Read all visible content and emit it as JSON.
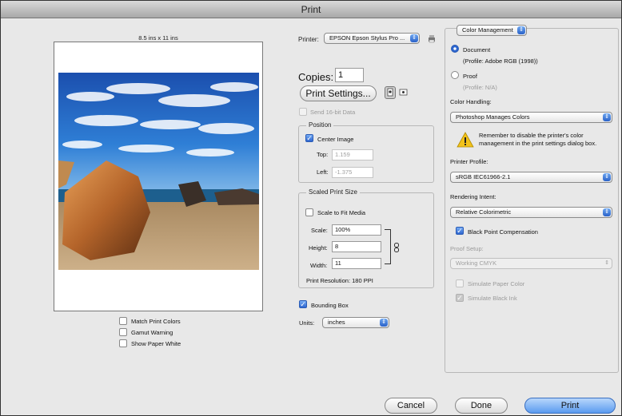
{
  "window": {
    "title": "Print"
  },
  "preview": {
    "paper_size": "8.5 ins x 11 ins"
  },
  "left_options": [
    {
      "label": "Match Print Colors",
      "checked": false
    },
    {
      "label": "Gamut Warning",
      "checked": false
    },
    {
      "label": "Show Paper White",
      "checked": false
    }
  ],
  "printer": {
    "label": "Printer:",
    "value": "EPSON Epson Stylus Pro ..."
  },
  "copies": {
    "label": "Copies:",
    "value": "1"
  },
  "print_settings_button": "Print Settings...",
  "send16bit": {
    "label": "Send 16-bit Data",
    "checked": false,
    "enabled": false
  },
  "position": {
    "title": "Position",
    "center_image": {
      "label": "Center Image",
      "checked": true
    },
    "top": {
      "label": "Top:",
      "value": "1.159"
    },
    "left": {
      "label": "Left:",
      "value": "-1.375"
    }
  },
  "scaled_print_size": {
    "title": "Scaled Print Size",
    "scale_to_fit": {
      "label": "Scale to Fit Media",
      "checked": false
    },
    "scale": {
      "label": "Scale:",
      "value": "100%"
    },
    "height": {
      "label": "Height:",
      "value": "8"
    },
    "width": {
      "label": "Width:",
      "value": "11"
    },
    "resolution": "Print Resolution: 180 PPI"
  },
  "bounding_box": {
    "label": "Bounding Box",
    "checked": true
  },
  "units": {
    "label": "Units:",
    "value": "inches"
  },
  "color_management": {
    "section": "Color Management",
    "document": {
      "label": "Document",
      "profile": "(Profile: Adobe RGB (1998))",
      "selected": true
    },
    "proof": {
      "label": "Proof",
      "profile": "(Profile: N/A)",
      "selected": false
    },
    "color_handling_label": "Color Handling:",
    "color_handling": "Photoshop Manages Colors",
    "warning": "Remember to disable the printer's color management in the print settings dialog box.",
    "printer_profile_label": "Printer Profile:",
    "printer_profile": "sRGB IEC61966-2.1",
    "rendering_intent_label": "Rendering Intent:",
    "rendering_intent": "Relative Colorimetric",
    "black_point": {
      "label": "Black Point Compensation",
      "checked": true
    },
    "proof_setup_label": "Proof Setup:",
    "proof_setup": "Working CMYK",
    "simulate_paper": {
      "label": "Simulate Paper Color",
      "checked": false
    },
    "simulate_ink": {
      "label": "Simulate Black Ink",
      "checked": true
    }
  },
  "buttons": {
    "cancel": "Cancel",
    "done": "Done",
    "print": "Print"
  },
  "colors": {
    "accent": "#2d66cf",
    "default_button": "#5b9bf0"
  }
}
